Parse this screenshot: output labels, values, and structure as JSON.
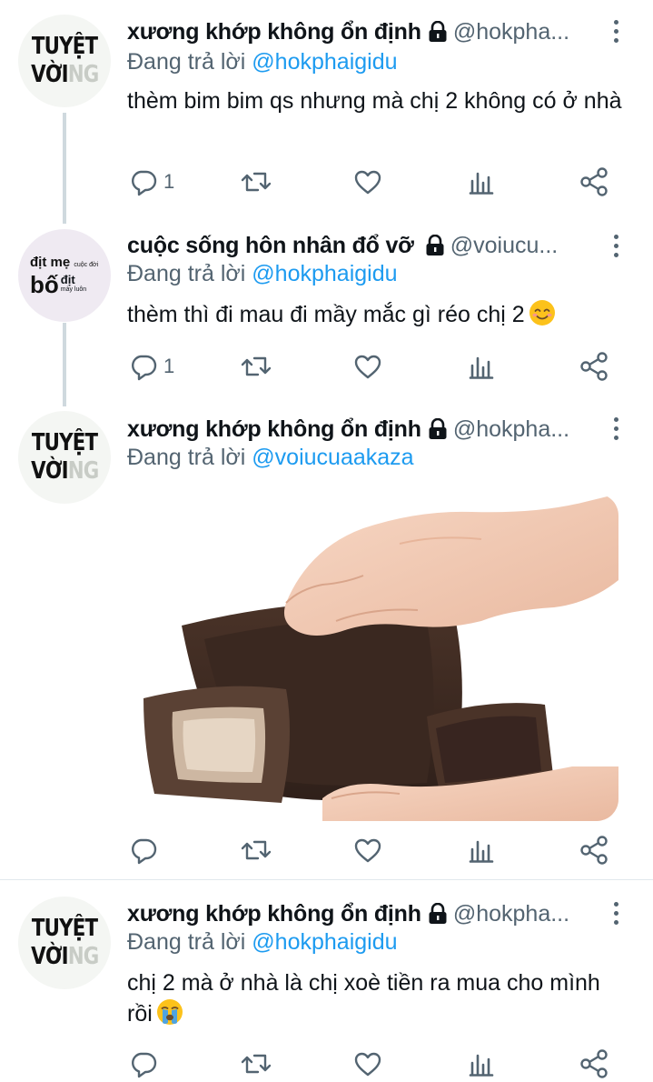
{
  "tweets": [
    {
      "avatar": {
        "kind": "tuyet-voi",
        "line1": "TUYỆT",
        "line2_main": "VỜI",
        "line2_fade": "NG"
      },
      "name": "xương khớp không ổn định",
      "handle": "@hokpha...",
      "reply_prefix": "Đang trả lời",
      "reply_mention": "@hokphaigidu",
      "text": "thèm bim bim qs nhưng mà chị 2 không có ở nhà",
      "reply_count": "1"
    },
    {
      "avatar": {
        "kind": "dit-me",
        "r1a": "địt mẹ",
        "r1b": "cuộc đời",
        "r2a": "bố",
        "r2b": "địt",
        "r2c": "mày luôn"
      },
      "name": "cuộc sống hôn nhân đổ vỡ",
      "handle": "@voiucu...",
      "reply_prefix": "Đang trả lời",
      "reply_mention": "@hokphaigidu",
      "text": "thèm thì đi mau đi mầy mắc gì réo chị 2",
      "emoji": "smiling-face",
      "reply_count": "1"
    },
    {
      "avatar": {
        "kind": "tuyet-voi",
        "line1": "TUYỆT",
        "line2_main": "VỜI",
        "line2_fade": "NG"
      },
      "name": "xương khớp không ổn định",
      "handle": "@hokpha...",
      "reply_prefix": "Đang trả lời",
      "reply_mention": "@voiucuaakaza",
      "media": "empty-wallet-photo",
      "reply_count": ""
    },
    {
      "avatar": {
        "kind": "tuyet-voi",
        "line1": "TUYỆT",
        "line2_main": "VỜI",
        "line2_fade": "NG"
      },
      "name": "xương khớp không ổn định",
      "handle": "@hokpha...",
      "reply_prefix": "Đang trả lời",
      "reply_mention": "@hokphaigidu",
      "text": "chị 2 mà ở nhà là chị xoè tiền ra mua cho mình rồi",
      "emoji": "crying-face",
      "reply_count": ""
    }
  ],
  "colors": {
    "text": "#0f1419",
    "secondary": "#536471",
    "link": "#1d9bf0",
    "thread_line": "#cfd9de"
  }
}
